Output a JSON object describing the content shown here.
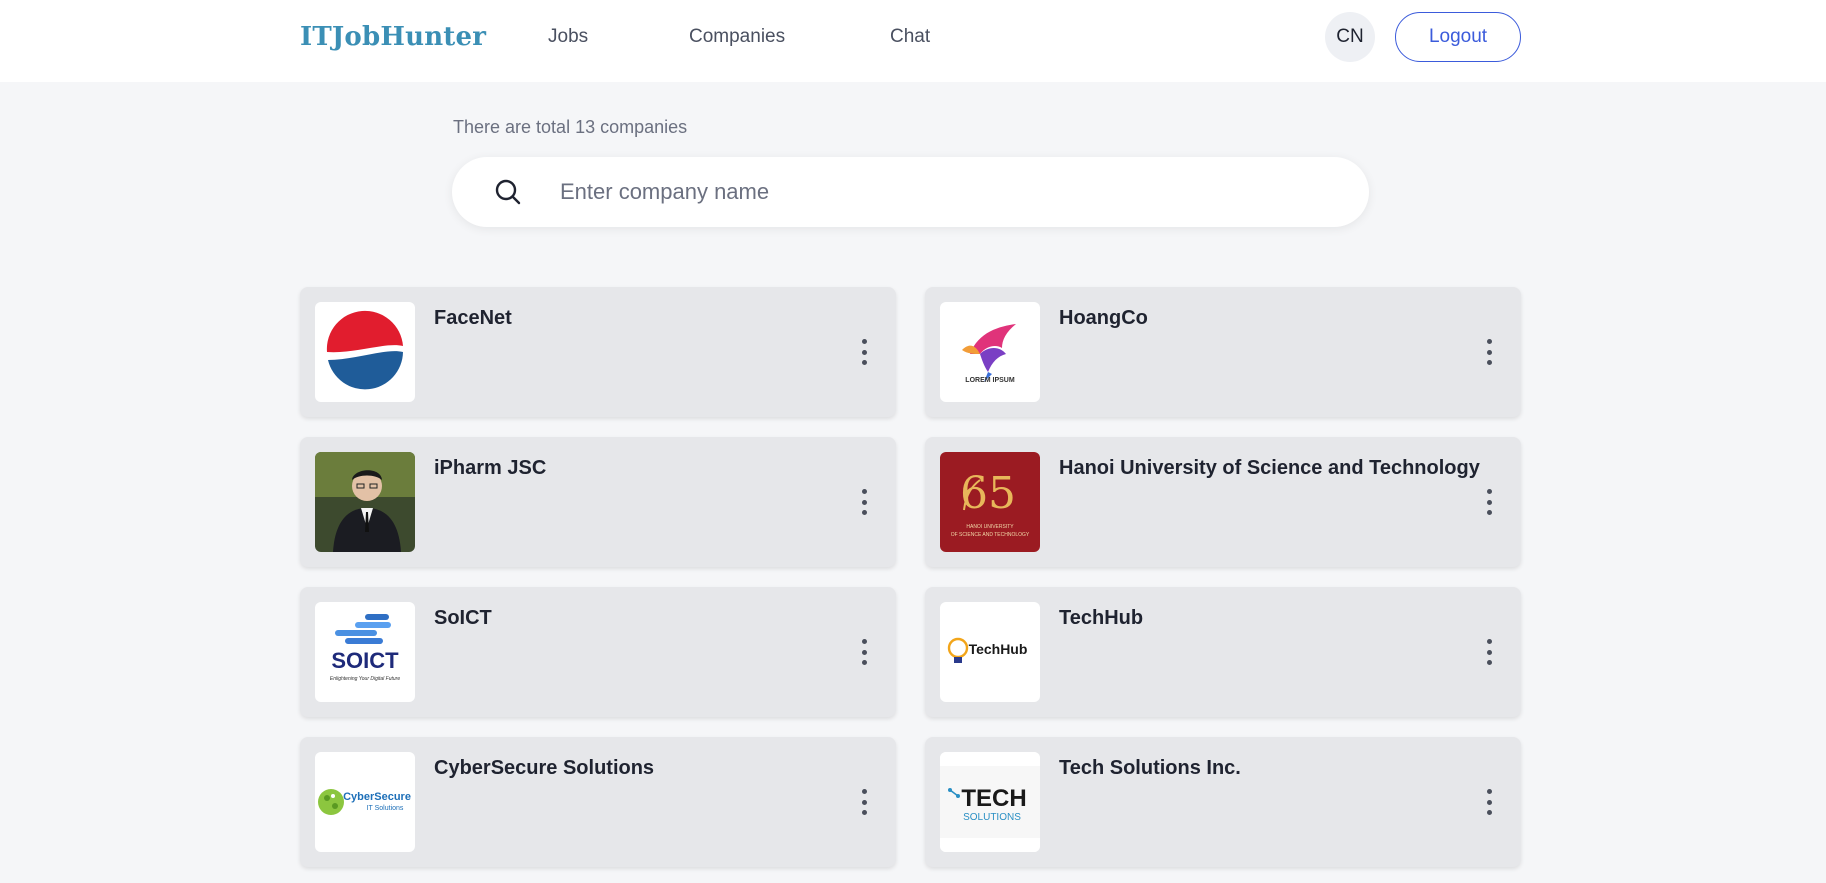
{
  "header": {
    "brand": "ITJobHunter",
    "nav": {
      "jobs": "Jobs",
      "companies": "Companies",
      "chat": "Chat"
    },
    "lang": "CN",
    "logout": "Logout",
    "accent_color": "#3b5bdb",
    "brand_color": "#3b8fb5"
  },
  "search": {
    "total_text": "There are total 13 companies",
    "placeholder": "Enter company name",
    "value": "",
    "icon": "search-icon"
  },
  "companies": [
    {
      "name": "FaceNet",
      "logo": "pepsi-style-globe-logo"
    },
    {
      "name": "HoangCo",
      "logo": "phoenix-bird-logo",
      "logo_text": "LOREM IPSUM"
    },
    {
      "name": "iPharm JSC",
      "logo": "person-photo"
    },
    {
      "name": "Hanoi University of Science and Technology",
      "logo": "hust-65-logo",
      "logo_text": "HANOI UNIVERSITY OF SCIENCE AND TECHNOLOGY"
    },
    {
      "name": "SoICT",
      "logo": "soict-logo",
      "logo_text": "SOICT",
      "logo_tagline": "Enlightening Your Digital Future"
    },
    {
      "name": "TechHub",
      "logo": "lightbulb-logo",
      "logo_text": "TechHub"
    },
    {
      "name": "CyberSecure Solutions",
      "logo": "cybersecure-globe-logo",
      "logo_text": "CyberSecure",
      "logo_subtext": "IT Solutions"
    },
    {
      "name": "Tech Solutions Inc.",
      "logo": "tech-solutions-logo",
      "logo_text": "TECH",
      "logo_subtext": "SOLUTIONS"
    }
  ]
}
